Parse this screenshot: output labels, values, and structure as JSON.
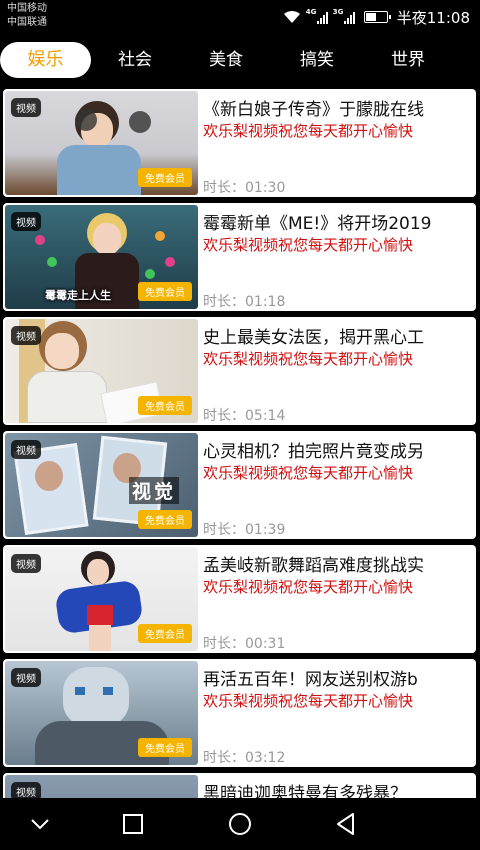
{
  "status": {
    "carrier1": "中国移动",
    "carrier2": "中国联通",
    "net1": "4G",
    "net2": "3G",
    "time": "半夜11:08",
    "battery_level": 0.5
  },
  "tabs": [
    {
      "label": "娱乐",
      "active": true
    },
    {
      "label": "社会",
      "active": false
    },
    {
      "label": "美食",
      "active": false
    },
    {
      "label": "搞笑",
      "active": false
    },
    {
      "label": "世界",
      "active": false
    }
  ],
  "badges": {
    "video": "视频",
    "free": "免费会员"
  },
  "duration_prefix": "时长：",
  "videos": [
    {
      "title": "《新白娘子传奇》于朦胧在线",
      "subtitle": "欢乐梨视频祝您每天都开心愉快",
      "duration": "01:30",
      "caption": ""
    },
    {
      "title": "霉霉新单《ME!》将开场2019",
      "subtitle": "欢乐梨视频祝您每天都开心愉快",
      "duration": "01:18",
      "caption": "霉霉走上人生"
    },
    {
      "title": "史上最美女法医，揭开黑心工",
      "subtitle": "欢乐梨视频祝您每天都开心愉快",
      "duration": "05:14",
      "caption": ""
    },
    {
      "title": "心灵相机？拍完照片竟变成另",
      "subtitle": "欢乐梨视频祝您每天都开心愉快",
      "duration": "01:39",
      "caption": "视觉"
    },
    {
      "title": "孟美岐新歌舞蹈高难度挑战实",
      "subtitle": "欢乐梨视频祝您每天都开心愉快",
      "duration": "00:31",
      "caption": ""
    },
    {
      "title": "再活五百年！网友送别权游b",
      "subtitle": "欢乐梨视频祝您每天都开心愉快",
      "duration": "03:12",
      "caption": ""
    },
    {
      "title": "黑暗迪迦奥特曼有多残暴？",
      "subtitle": "",
      "duration": "",
      "caption": ""
    }
  ],
  "icons": {
    "wifi": "wifi-icon",
    "battery": "battery-icon",
    "back": "back-triangle-icon",
    "home": "home-circle-icon",
    "recent": "recent-square-icon",
    "hide": "chevron-down-icon"
  }
}
